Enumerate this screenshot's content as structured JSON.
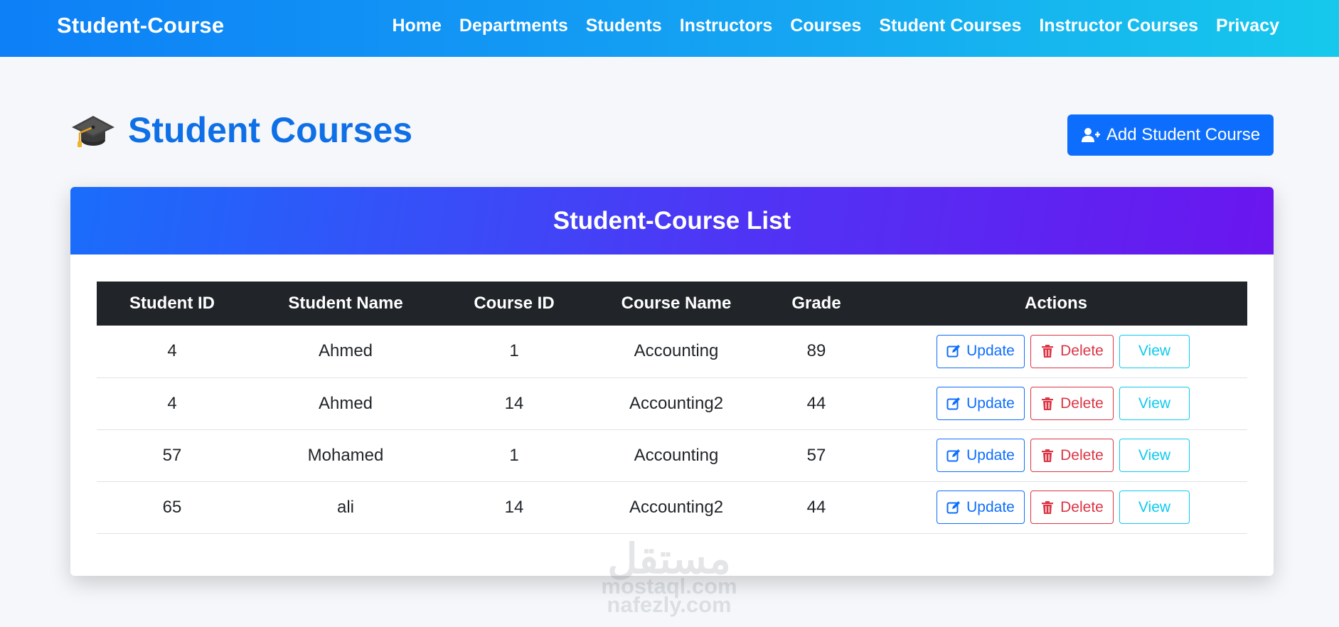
{
  "navbar": {
    "brand": "Student-Course",
    "links": [
      "Home",
      "Departments",
      "Students",
      "Instructors",
      "Courses",
      "Student Courses",
      "Instructor Courses",
      "Privacy"
    ]
  },
  "page": {
    "icon": "graduation-cap-icon",
    "title": "Student Courses",
    "add_button_label": "Add Student Course",
    "add_button_icon": "user-plus-icon"
  },
  "card": {
    "title": "Student-Course List",
    "columns": [
      "Student ID",
      "Student Name",
      "Course ID",
      "Course Name",
      "Grade",
      "Actions"
    ],
    "rows": [
      {
        "student_id": "4",
        "student_name": "Ahmed",
        "course_id": "1",
        "course_name": "Accounting",
        "grade": "89"
      },
      {
        "student_id": "4",
        "student_name": "Ahmed",
        "course_id": "14",
        "course_name": "Accounting2",
        "grade": "44"
      },
      {
        "student_id": "57",
        "student_name": "Mohamed",
        "course_id": "1",
        "course_name": "Accounting",
        "grade": "57"
      },
      {
        "student_id": "65",
        "student_name": "ali",
        "course_id": "14",
        "course_name": "Accounting2",
        "grade": "44"
      }
    ],
    "actions": {
      "update": "Update",
      "delete": "Delete",
      "view": "View"
    }
  },
  "watermark": {
    "logo": "مستقل",
    "line1": "mostaql.com",
    "line2": "nafezly.com"
  },
  "colors": {
    "primary": "#0d6efd",
    "danger": "#dc3545",
    "info": "#0dcaf0",
    "table_header": "#212529",
    "title": "#0f6fe6"
  }
}
